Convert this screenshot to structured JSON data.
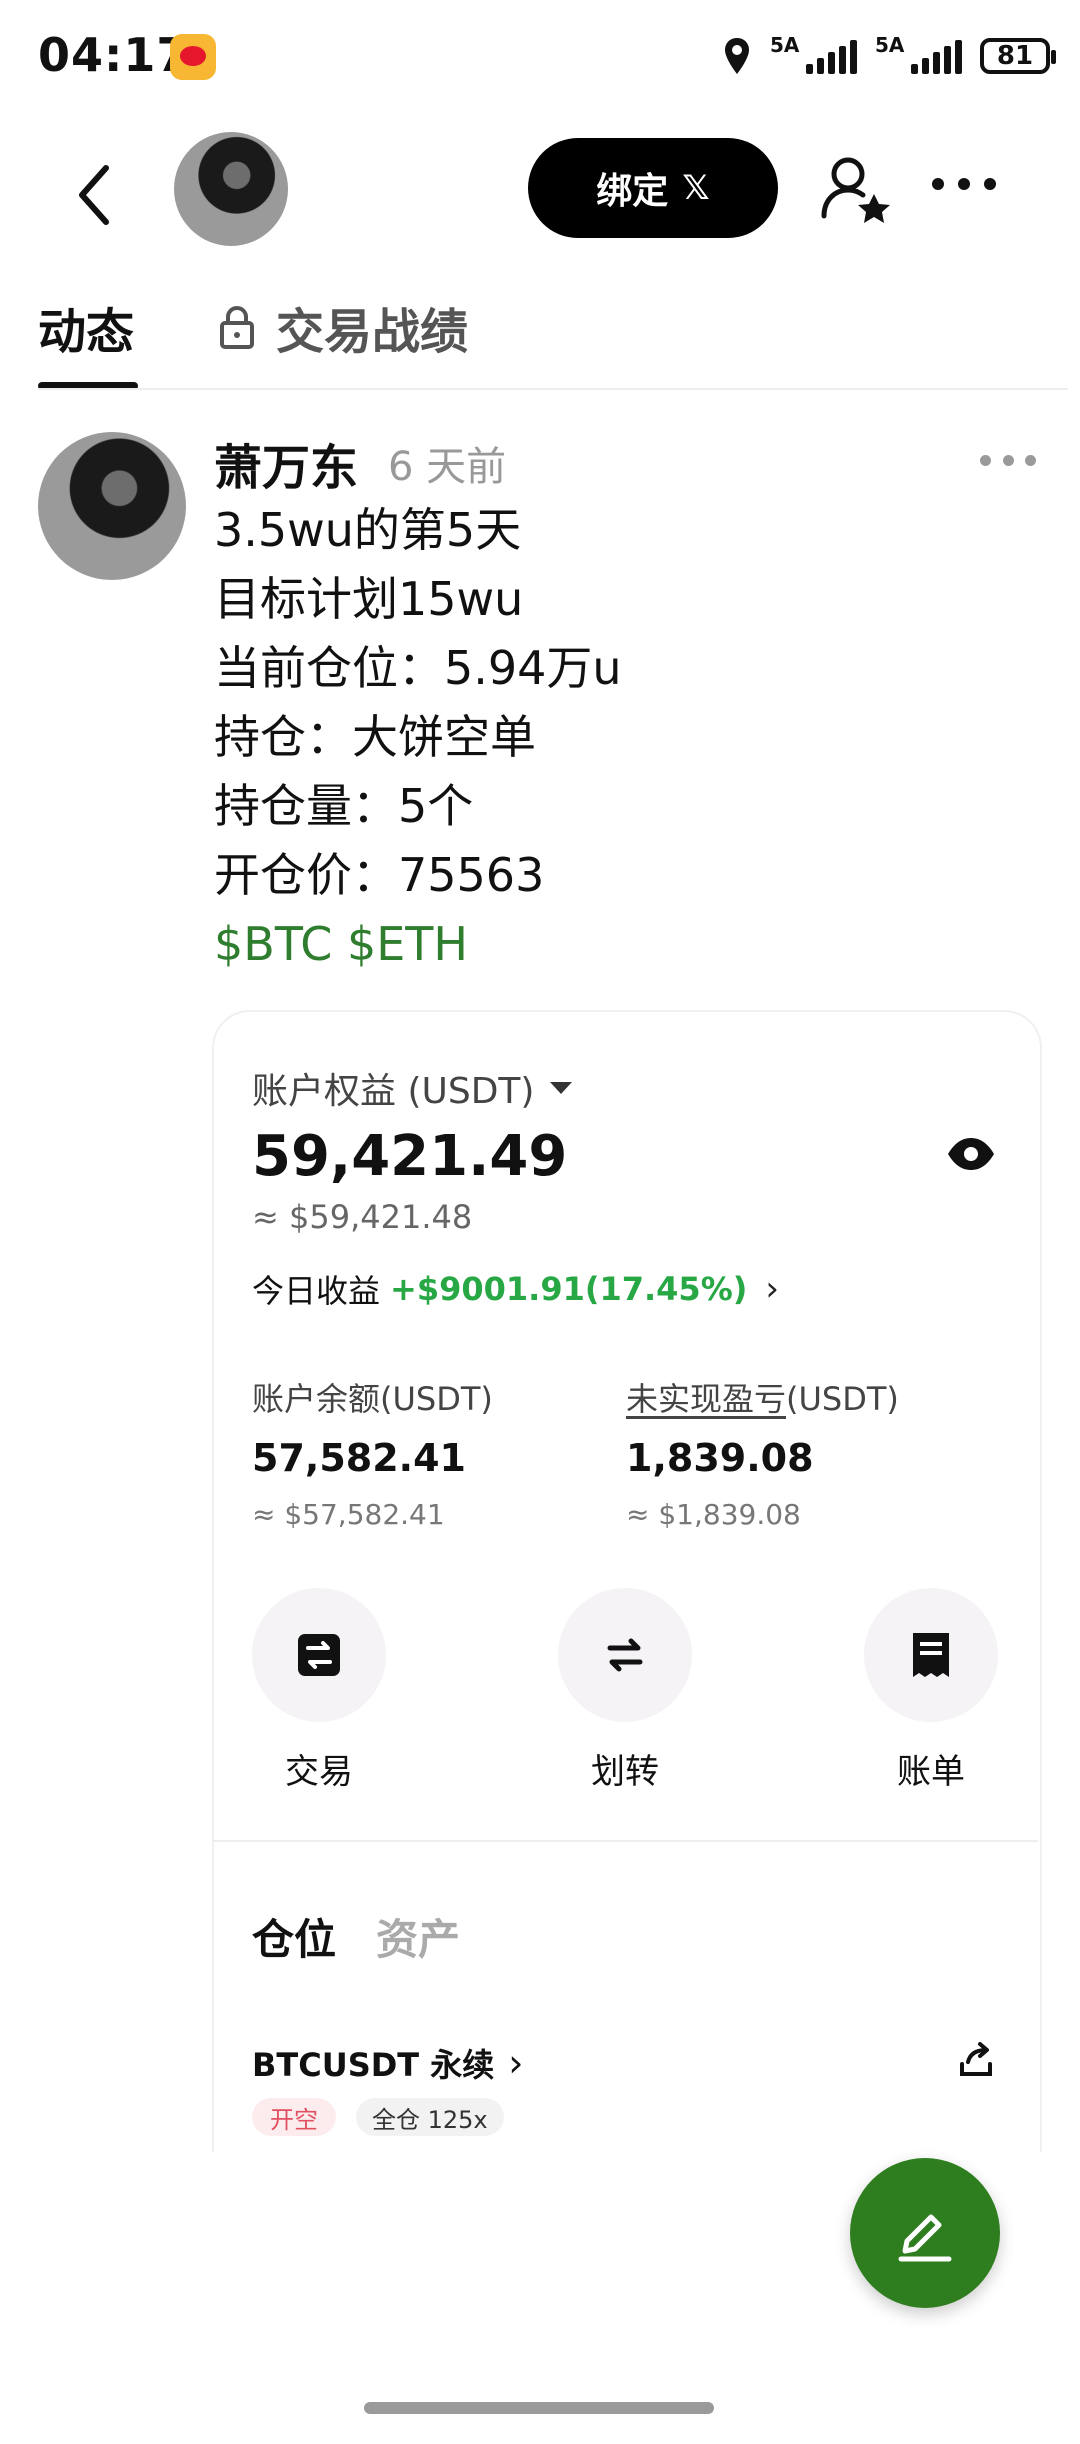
{
  "status_bar": {
    "time": "04:17",
    "app_icon": "weibo-icon",
    "signal1_label": "5A",
    "signal2_label": "5A",
    "battery": "81"
  },
  "header": {
    "bind_label": "绑定",
    "bind_x": "𝕏"
  },
  "tabs": {
    "active": "动态",
    "locked": "交易战绩"
  },
  "post": {
    "author": "萧万东",
    "time": "6 天前",
    "lines": [
      "3.5wu的第5天",
      "目标计划15wu",
      "当前仓位：5.94万u",
      "持仓：大饼空单",
      "持仓量：5个",
      "开仓价：75563"
    ],
    "tags": "$BTC $ETH"
  },
  "card": {
    "equity_label": "账户权益 (USDT)",
    "equity_value": "59,421.49",
    "equity_usd": "≈ $59,421.48",
    "today_label": "今日收益",
    "today_value": "+$9001.91(17.45%)",
    "balance_label": "账户余额(USDT)",
    "balance_value": "57,582.41",
    "balance_usd": "≈ $57,582.41",
    "pnl_label_main": "未实现盈亏",
    "pnl_label_unit": "(USDT)",
    "pnl_value": "1,839.08",
    "pnl_usd": "≈ $1,839.08",
    "actions": [
      "交易",
      "划转",
      "账单"
    ],
    "tab_positions": "仓位",
    "tab_assets": "资产",
    "position_name": "BTCUSDT 永续",
    "badge_short": "开空",
    "badge_margin": "全仓 125x"
  },
  "colors": {
    "accent_green": "#2e7d1f",
    "profit_green": "#28a745",
    "short_red": "#e05262"
  }
}
